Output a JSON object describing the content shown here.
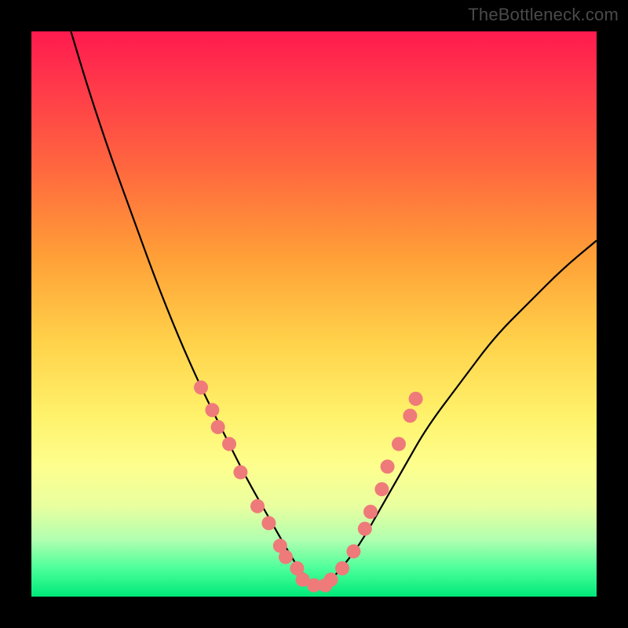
{
  "attribution": "TheBottleneck.com",
  "chart_data": {
    "type": "line",
    "title": "",
    "xlabel": "",
    "ylabel": "",
    "xlim": [
      0,
      100
    ],
    "ylim": [
      0,
      100
    ],
    "grid": false,
    "series": [
      {
        "name": "bottleneck-curve",
        "x": [
          7,
          10,
          14,
          18,
          22,
          26,
          30,
          34,
          38,
          42,
          46,
          48,
          50,
          52,
          54,
          58,
          62,
          66,
          70,
          76,
          82,
          88,
          94,
          100
        ],
        "y": [
          100,
          90,
          78,
          67,
          56,
          46,
          37,
          29,
          21,
          14,
          7,
          4,
          2,
          2,
          4,
          9,
          16,
          23,
          30,
          38,
          46,
          52,
          58,
          63
        ]
      }
    ],
    "markers": [
      {
        "name": "left-cluster",
        "points": [
          {
            "x": 30,
            "y": 37
          },
          {
            "x": 32,
            "y": 33
          },
          {
            "x": 33,
            "y": 30
          },
          {
            "x": 35,
            "y": 27
          },
          {
            "x": 37,
            "y": 22
          },
          {
            "x": 40,
            "y": 16
          },
          {
            "x": 42,
            "y": 13
          }
        ]
      },
      {
        "name": "valley-cluster",
        "points": [
          {
            "x": 44,
            "y": 9
          },
          {
            "x": 45,
            "y": 7
          },
          {
            "x": 47,
            "y": 5
          },
          {
            "x": 48,
            "y": 3
          },
          {
            "x": 50,
            "y": 2
          },
          {
            "x": 52,
            "y": 2
          },
          {
            "x": 53,
            "y": 3
          },
          {
            "x": 55,
            "y": 5
          }
        ]
      },
      {
        "name": "right-cluster",
        "points": [
          {
            "x": 57,
            "y": 8
          },
          {
            "x": 59,
            "y": 12
          },
          {
            "x": 60,
            "y": 15
          },
          {
            "x": 62,
            "y": 19
          },
          {
            "x": 63,
            "y": 23
          },
          {
            "x": 65,
            "y": 27
          },
          {
            "x": 67,
            "y": 32
          },
          {
            "x": 68,
            "y": 35
          }
        ]
      }
    ],
    "marker_color": "#ef7a7a",
    "curve_color": "#000000",
    "background": "gradient"
  }
}
